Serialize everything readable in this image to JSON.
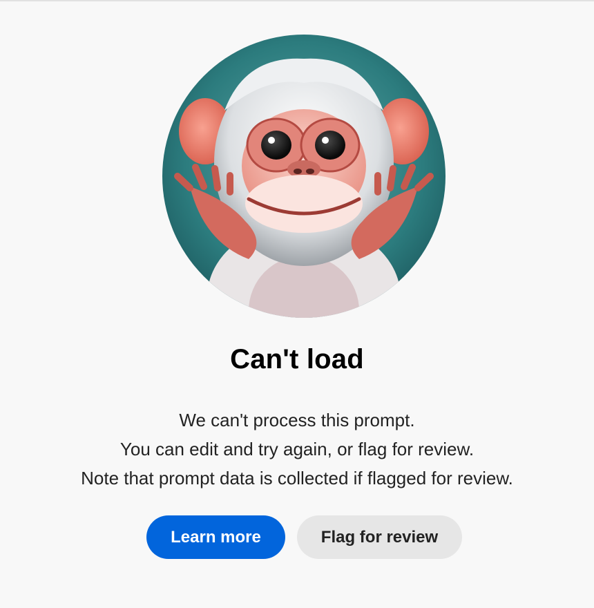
{
  "illustration": {
    "icon": "monkey-illustration"
  },
  "error": {
    "title": "Can't load",
    "lines": [
      "We can't process this prompt.",
      "You can edit and try again, or flag for review.",
      "Note that prompt data is collected if flagged for review."
    ]
  },
  "actions": {
    "learn_more": "Learn more",
    "flag_for_review": "Flag for review"
  },
  "colors": {
    "background": "#f8f8f8",
    "primary_button": "#0265dc",
    "secondary_button": "#e6e6e6"
  }
}
